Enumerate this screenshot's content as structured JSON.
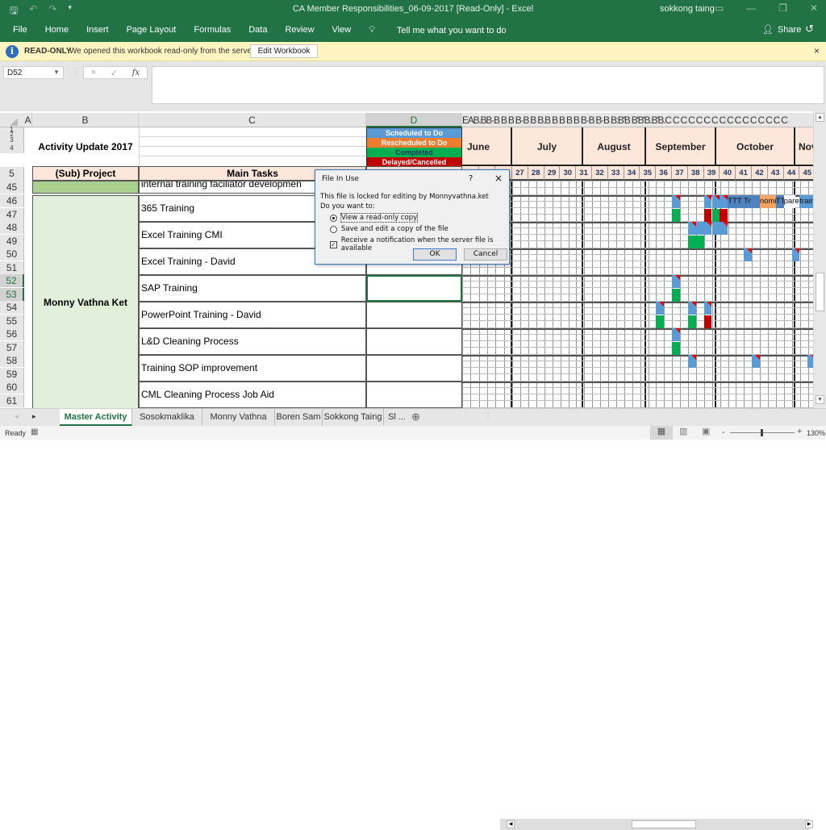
{
  "titlebar": {
    "title": "CA Member Responsibilities_06-09-2017  [Read-Only]  -  Excel",
    "user": "sokkong taing",
    "qat": {
      "save_icon": "save-icon",
      "undo_icon": "undo-icon",
      "redo_icon": "redo-icon",
      "customize_icon": "customize-qat-icon"
    },
    "window_controls": [
      "ribbon-display-options",
      "minimize",
      "restore",
      "close"
    ]
  },
  "ribbon": {
    "tabs": [
      "File",
      "Home",
      "Insert",
      "Page Layout",
      "Formulas",
      "Data",
      "Review",
      "View"
    ],
    "tell_me": "Tell me what you want to do",
    "share": "Share"
  },
  "message_bar": {
    "label": "READ-ONLY",
    "message": "We opened this workbook read-only from the server.",
    "button": "Edit Workbook",
    "close": "×"
  },
  "formula_bar": {
    "name_box": "D52",
    "cancel": "×",
    "enter": "✓",
    "fx": "fx",
    "formula": ""
  },
  "columns": {
    "A": "A",
    "B": "B",
    "C": "C",
    "D": "D",
    "narrow_headers": "EAB.BB·B B B B·B B B.B B B B B B·B B·B B:B'B B'B'B.B'B.C C C C C C C C C C C C C C C C"
  },
  "rows": [
    "1",
    "2",
    "3",
    "4",
    "5",
    "45",
    "46",
    "47",
    "48",
    "49",
    "50",
    "51",
    "52",
    "53",
    "54",
    "55",
    "56",
    "57",
    "58",
    "59",
    "60",
    "61"
  ],
  "sheet": {
    "title": "Activity Update 2017",
    "header_project": "(Sub) Project",
    "header_tasks": "Main Tasks",
    "legend": [
      {
        "label": "Scheduled to Do",
        "color": "#5b9bd5",
        "text": "#ffffff"
      },
      {
        "label": "Rescheduled to Do",
        "color": "#ed7d31",
        "text": "#ffffff"
      },
      {
        "label": "Completed",
        "color": "#00b050",
        "text": "#1f3864"
      },
      {
        "label": "Delayed/Cancelled",
        "color": "#c00000",
        "text": "#ffffff"
      }
    ],
    "months": [
      "June",
      "July",
      "August",
      "September",
      "October",
      "Nov"
    ],
    "weeks": [
      "27",
      "28",
      "29",
      "30",
      "31",
      "32",
      "33",
      "34",
      "35",
      "36",
      "37",
      "38",
      "39",
      "40",
      "41",
      "42",
      "43",
      "44",
      "45"
    ],
    "row45_task": "internal training faciliator developmen",
    "person": "Monny Vathna Ket",
    "tasks": [
      "365 Training",
      "Excel Training CMI",
      "Excel Training - David",
      "SAP Training",
      "PowerPoint Training - David",
      "L&D Cleaning Process",
      "Training SOP improvement",
      "CML Cleaning Process Job Aid"
    ],
    "bar_text": {
      "t1": "TTT Tr",
      "t2": "nomi",
      "t3": "TTT",
      "t4": "pare",
      "t5": "training"
    }
  },
  "dialog": {
    "title": "File In Use",
    "help": "?",
    "close": "×",
    "message": "This file is locked for editing by Monnyvathna.ket",
    "question": "Do you want to:",
    "options": [
      {
        "label": "View a read-only copy",
        "selected": true
      },
      {
        "label": "Save and edit a copy of the file",
        "selected": false
      }
    ],
    "notify": {
      "label": "Receive a notification when the server file is available",
      "checked": true
    },
    "ok": "OK",
    "cancel": "Cancel"
  },
  "sheet_tabs": {
    "tabs": [
      "Master Activity Plan",
      "Sosokmaklika Eng",
      "Monny Vathna Ket",
      "Boren Sam",
      "Sokkong Taing",
      "Sl ..."
    ],
    "active": "Master Activity Plan",
    "add": "⊕"
  },
  "status_bar": {
    "status": "Ready",
    "zoom": "130%",
    "zoom_level_percent": 130
  }
}
